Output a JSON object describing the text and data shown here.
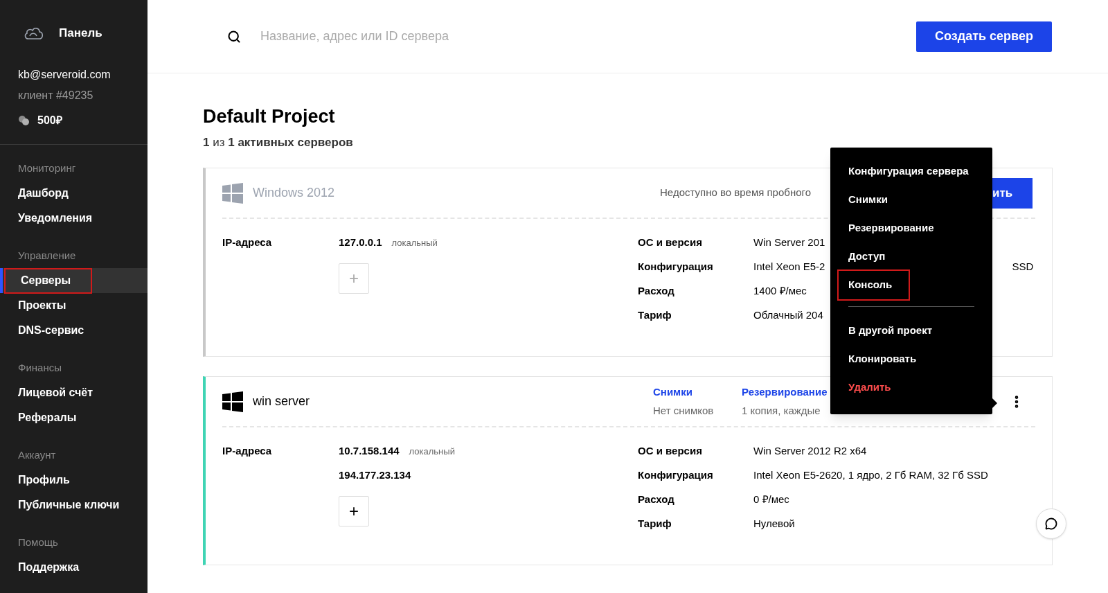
{
  "sidebar": {
    "brand": "Панель",
    "email": "kb@serveroid.com",
    "client": "клиент #49235",
    "balance": "500₽",
    "sections": [
      {
        "title": "Мониторинг",
        "items": [
          {
            "label": "Дашборд",
            "selected": false,
            "outlined": false
          },
          {
            "label": "Уведомления",
            "selected": false,
            "outlined": false
          }
        ]
      },
      {
        "title": "Управление",
        "items": [
          {
            "label": "Серверы",
            "selected": true,
            "outlined": true
          },
          {
            "label": "Проекты",
            "selected": false,
            "outlined": false
          },
          {
            "label": "DNS-сервис",
            "selected": false,
            "outlined": false
          }
        ]
      },
      {
        "title": "Финансы",
        "items": [
          {
            "label": "Лицевой счёт",
            "selected": false,
            "outlined": false
          },
          {
            "label": "Рефералы",
            "selected": false,
            "outlined": false
          }
        ]
      },
      {
        "title": "Аккаунт",
        "items": [
          {
            "label": "Профиль",
            "selected": false,
            "outlined": false
          },
          {
            "label": "Публичные ключи",
            "selected": false,
            "outlined": false
          }
        ]
      },
      {
        "title": "Помощь",
        "items": [
          {
            "label": "Поддержка",
            "selected": false,
            "outlined": false
          }
        ]
      }
    ]
  },
  "header": {
    "search": {
      "placeholder": "Название, адрес или ID сервера"
    },
    "create_button": "Создать сервер"
  },
  "project": {
    "title": "Default Project",
    "subtitle": "**1** из **1 активных серверов**"
  },
  "servers": [
    {
      "name": "Windows 2012",
      "active": false,
      "status_text": "Недоступно во время пробного",
      "action_button": "ить",
      "ip_label": "IP-адреса",
      "ips": [
        {
          "address": "127.0.0.1",
          "note": "локальный"
        }
      ],
      "add_ip": "+",
      "specs": [
        {
          "label": "ОС и версия",
          "value": "Win Server 201"
        },
        {
          "label": "Конфигурация",
          "value": "Intel Xeon E5-2",
          "tail": "SSD"
        },
        {
          "label": "Расход",
          "value": "1400 ₽/мес"
        },
        {
          "label": "Тариф",
          "value": "Облачный 204"
        }
      ]
    },
    {
      "name": "win server",
      "active": true,
      "summaries": [
        {
          "title": "Снимки",
          "value": "Нет снимков"
        },
        {
          "title": "Резервирование",
          "value": "1 копия, каждые"
        }
      ],
      "ip_label": "IP-адреса",
      "ips": [
        {
          "address": "10.7.158.144",
          "note": "локальный"
        },
        {
          "address": "194.177.23.134"
        }
      ],
      "add_ip": "+",
      "specs": [
        {
          "label": "ОС и версия",
          "value": "Win Server 2012 R2 x64"
        },
        {
          "label": "Конфигурация",
          "value": "Intel Xeon E5-2620, 1 ядро, 2 Гб RAM, 32 Гб SSD"
        },
        {
          "label": "Расход",
          "value": "0 ₽/мес"
        },
        {
          "label": "Тариф",
          "value": "Нулевой"
        }
      ]
    }
  ],
  "context_menu": {
    "groups": [
      [
        {
          "label": "Конфигурация сервера",
          "danger": false,
          "outlined": false
        },
        {
          "label": "Снимки",
          "danger": false,
          "outlined": false
        },
        {
          "label": "Резервирование",
          "danger": false,
          "outlined": false
        },
        {
          "label": "Доступ",
          "danger": false,
          "outlined": false
        },
        {
          "label": "Консоль",
          "danger": false,
          "outlined": true
        }
      ],
      [
        {
          "label": "В другой проект",
          "danger": false,
          "outlined": false
        },
        {
          "label": "Клонировать",
          "danger": false,
          "outlined": false
        },
        {
          "label": "Удалить",
          "danger": true,
          "outlined": false
        }
      ]
    ]
  }
}
